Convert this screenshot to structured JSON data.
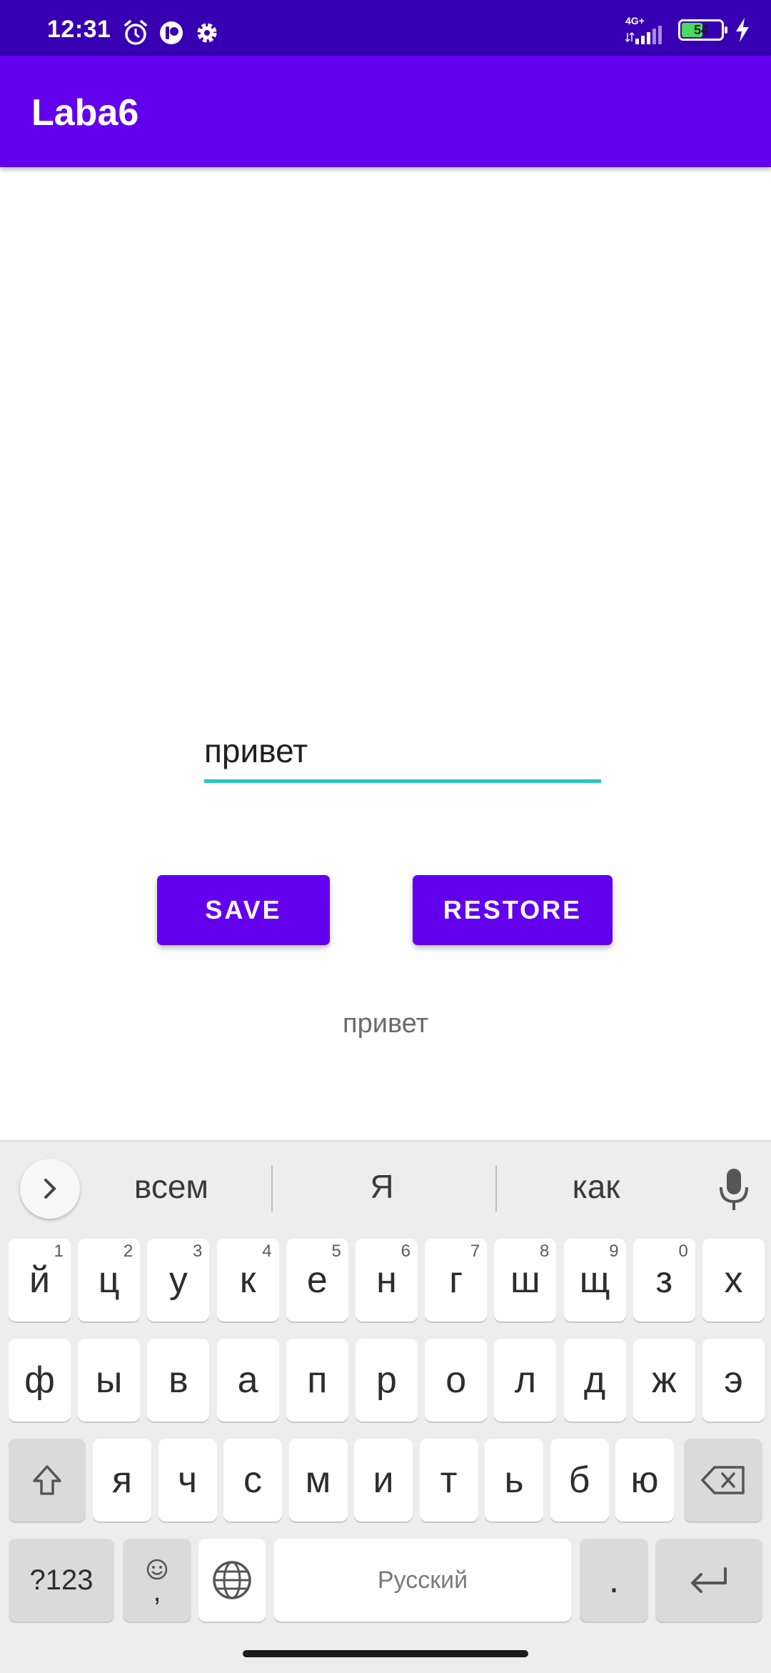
{
  "status_bar": {
    "time": "12:31",
    "network": "4G+",
    "battery": "54",
    "battery_level": 0.54
  },
  "app_bar": {
    "title": "Laba6"
  },
  "main": {
    "input_value": "привет",
    "save_label": "SAVE",
    "restore_label": "RESTORE",
    "result_text": "привет"
  },
  "keyboard": {
    "suggestions": [
      "всем",
      "Я",
      "как"
    ],
    "row1": [
      {
        "k": "й",
        "h": "1"
      },
      {
        "k": "ц",
        "h": "2"
      },
      {
        "k": "у",
        "h": "3"
      },
      {
        "k": "к",
        "h": "4"
      },
      {
        "k": "е",
        "h": "5"
      },
      {
        "k": "н",
        "h": "6"
      },
      {
        "k": "г",
        "h": "7"
      },
      {
        "k": "ш",
        "h": "8"
      },
      {
        "k": "щ",
        "h": "9"
      },
      {
        "k": "з",
        "h": "0"
      },
      {
        "k": "х",
        "h": ""
      }
    ],
    "row2": [
      "ф",
      "ы",
      "в",
      "а",
      "п",
      "р",
      "о",
      "л",
      "д",
      "ж",
      "э"
    ],
    "row3": [
      "я",
      "ч",
      "с",
      "м",
      "и",
      "т",
      "ь",
      "б",
      "ю"
    ],
    "symbols_label": "?123",
    "comma_label": ",",
    "space_label": "Русский",
    "period_label": ".",
    "colors": {
      "accent": "#6200EE",
      "status_bar": "#3700B3",
      "input_underline": "#26C6C6"
    }
  }
}
